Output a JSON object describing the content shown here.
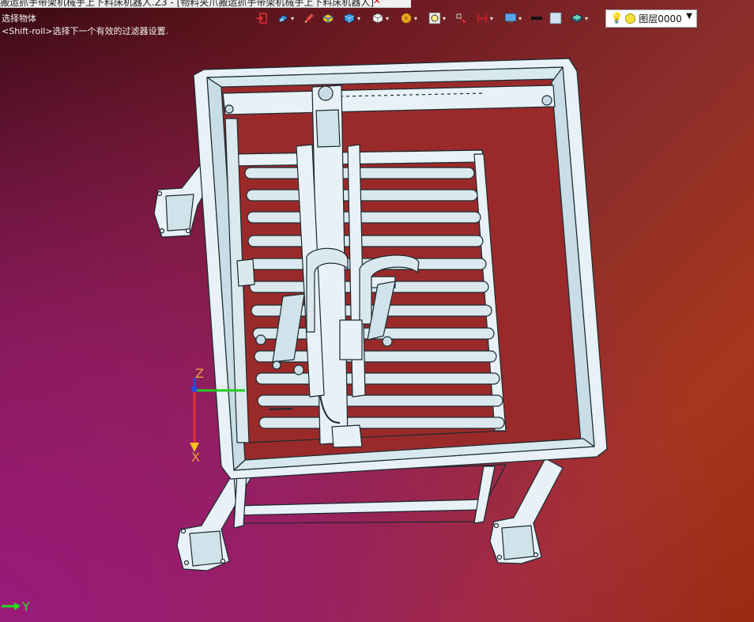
{
  "window": {
    "tab_title": "搬运抓手带架机械手上下料床机器人.Z3 - [物料夹爪搬运抓手带架机械手上下料床机器人]",
    "tab_close": "✕"
  },
  "status": {
    "line1": "选择物体",
    "line2": "<Shift-roll>选择下一个有效的过滤器设置."
  },
  "toolbar": {
    "icons": [
      "exit-icon",
      "view-icon",
      "pencil-icon",
      "solid-icon",
      "cube-icon",
      "box-icon",
      "render-icon",
      "zoom-fit-icon",
      "transform-icon",
      "dimension-icon",
      "display-icon",
      "line-color-icon",
      "color-swatch-icon",
      "layer-stack-icon"
    ]
  },
  "layer": {
    "name": "图层0000",
    "bulb_icon": "lightbulb-icon",
    "dot_color": "#f2e23a"
  },
  "axes": {
    "triad_z": "Z",
    "triad_x": "X",
    "corner_y": "Y"
  },
  "colors": {
    "model_fill": "#e8f2f6",
    "model_stroke": "#1a2a30",
    "model_shade": "#a8c4d0"
  }
}
